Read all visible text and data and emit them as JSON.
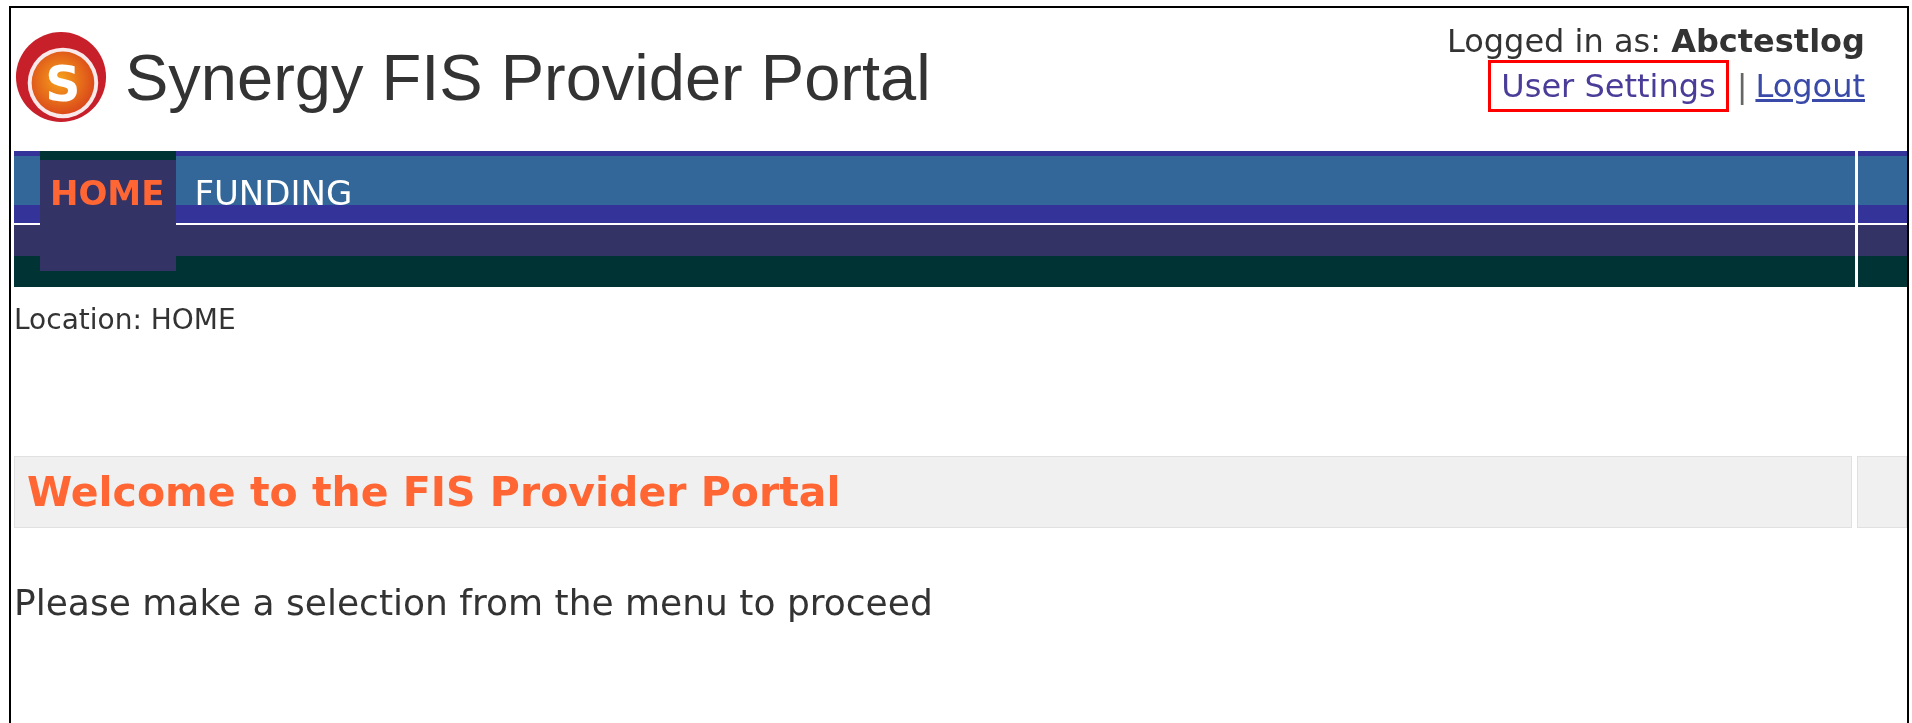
{
  "header": {
    "logo": {
      "letter": "S"
    },
    "title": "Synergy FIS Provider Portal",
    "login": {
      "label": "Logged in as:",
      "user": "Abctestlog"
    },
    "links": [
      {
        "label": "User Settings",
        "highlighted": true
      },
      {
        "label": "Logout",
        "highlighted": false
      }
    ],
    "separator": "|"
  },
  "nav": {
    "tabs": [
      {
        "label": "HOME",
        "selected": true
      },
      {
        "label": "FUNDING",
        "selected": false
      }
    ]
  },
  "location": {
    "label": "Location:",
    "value": "HOME"
  },
  "welcome": {
    "title": "Welcome to the FIS Provider Portal"
  },
  "message": "Please make a selection from the menu to proceed"
}
